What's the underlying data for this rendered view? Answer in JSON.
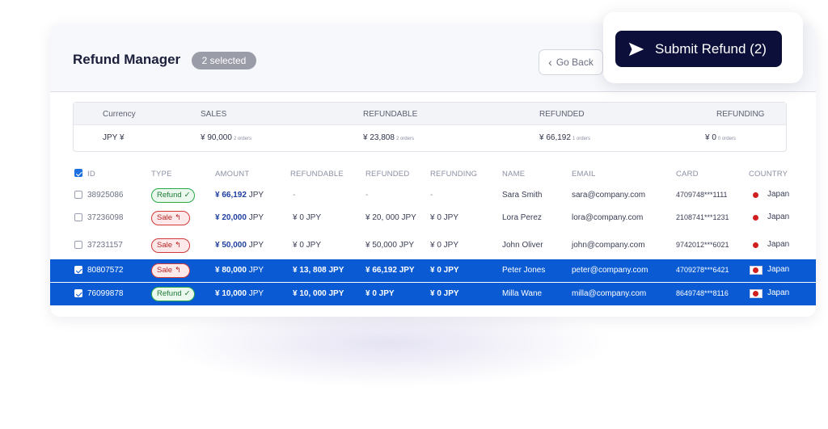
{
  "header": {
    "title": "Refund Manager",
    "selected_badge": "2 selected",
    "go_back": "Go Back",
    "submit": "Submit Refund (2)"
  },
  "summary": {
    "headers": [
      "Currency",
      "SALES",
      "REFUNDABLE",
      "REFUNDED",
      "REFUNDING"
    ],
    "currency": "JPY ¥",
    "sales": "¥ 90,000",
    "sales_orders": "2 orders",
    "refundable": "¥ 23,808",
    "refundable_orders": "2 orders",
    "refunded": "¥ 66,192",
    "refunded_orders": "1 orders",
    "refunding": "¥ 0",
    "refunding_orders": "0 orders"
  },
  "table": {
    "columns": [
      "ID",
      "TYPE",
      "AMOUNT",
      "REFUNDABLE",
      "REFUNDED",
      "REFUNDING",
      "NAME",
      "EMAIL",
      "CARD",
      "COUNTRY"
    ],
    "rows": [
      {
        "id": "38925086",
        "type": "Refund",
        "amount": "¥ 66,192",
        "amount_unit": "JPY",
        "refundable": "-",
        "refunded": "-",
        "refunding": "-",
        "name": "Sara Smith",
        "email": "sara@company.com",
        "card": "4709748***1111",
        "country": "Japan",
        "selected": false
      },
      {
        "id": "37236098",
        "type": "Sale",
        "amount": "¥ 20,000",
        "amount_unit": "JPY",
        "refundable": "¥ 0 JPY",
        "refunded": "¥ 20, 000 JPY",
        "refunding": "¥ 0 JPY",
        "name": "Lora Perez",
        "email": "lora@company.com",
        "card": "2108741***1231",
        "country": "Japan",
        "selected": false
      },
      {
        "id": "37231157",
        "type": "Sale",
        "amount": "¥ 50,000",
        "amount_unit": "JPY",
        "refundable": "¥ 0 JPY",
        "refunded": "¥ 50,000 JPY",
        "refunding": "¥ 0 JPY",
        "name": "John Oliver",
        "email": "john@company.com",
        "card": "9742012***6021",
        "country": "Japan",
        "selected": false
      },
      {
        "id": "80807572",
        "type": "Sale",
        "amount": "¥ 80,000",
        "amount_unit": "JPY",
        "refundable": "¥ 13, 808 JPY",
        "refunded": "¥ 66,192 JPY",
        "refunding": "¥ 0 JPY",
        "name": "Peter Jones",
        "email": "peter@company.com",
        "card": "4709278***6421",
        "country": "Japan",
        "selected": true
      },
      {
        "id": "76099878",
        "type": "Refund",
        "amount": "¥ 10,000",
        "amount_unit": "JPY",
        "refundable": "¥ 10, 000 JPY",
        "refunded": "¥ 0 JPY",
        "refunding": "¥ 0 JPY",
        "name": "Milla Wane",
        "email": "milla@company.com",
        "card": "8649748***8116",
        "country": "Japan",
        "selected": true
      }
    ]
  },
  "colors": {
    "selection": "#0a5bd3",
    "submit_bg": "#0c0f3a",
    "refund_pill": "#2aa84a",
    "sale_pill": "#d23b3b"
  },
  "icons": {
    "submit": "send-icon",
    "go_back": "chevron-left-icon",
    "refund": "check-icon",
    "sale": "undo-arrow-icon",
    "country": "japan-flag-icon"
  }
}
